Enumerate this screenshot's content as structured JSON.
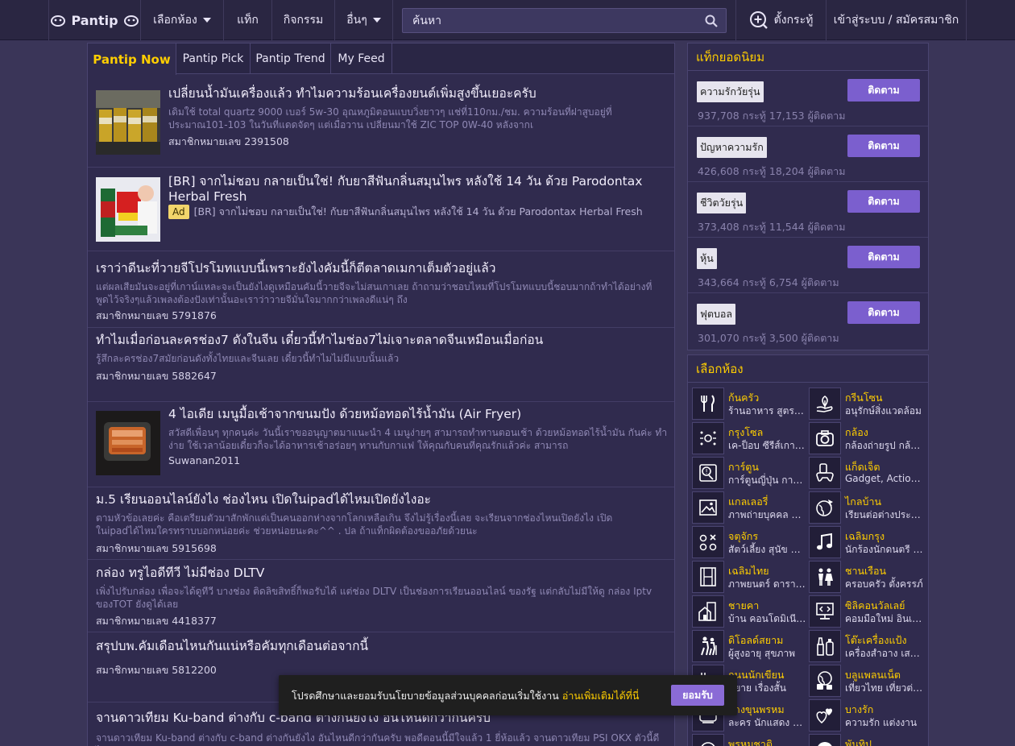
{
  "header": {
    "logo": "Pantip",
    "nav": [
      {
        "label": "เลือกห้อง",
        "dropdown": true
      },
      {
        "label": "แท็ก",
        "dropdown": false
      },
      {
        "label": "กิจกรรม",
        "dropdown": false
      },
      {
        "label": "อื่นๆ",
        "dropdown": true
      }
    ],
    "search_placeholder": "ค้นหา",
    "post_label": "ตั้งกระทู้",
    "login_label": "เข้าสู่ระบบ / สมัครสมาชิก"
  },
  "feed": {
    "tabs": [
      "Pantip Now",
      "Pantip Pick",
      "Pantip Trend",
      "My Feed"
    ],
    "active_tab": "Pantip Now",
    "items": [
      {
        "title": "เปลี่ยนน้ำมันเครื่องแล้ว ทำไมความร้อนเครื่องยนต์เพิ่มสูงขึ้นเยอะครับ",
        "excerpt": "เดิมใช้ total quartz 9000 เบอร์ 5w-30 อุณหภูมิตอนแบบวิ่งยาวๆ แช่ที่110กม./ชม. ความร้อนที่ฝาสูบอยู่ที่ประมาณ101-103 ในวันที่แดดจัดๆ แต่เมื่อวาน เปลี่ยนมาใช้ ZIC TOP 0W-40 หลังจากเ",
        "author": "สมาชิกหมายเลข 2391508",
        "thumb": "oil"
      },
      {
        "title": "[BR] จากไม่ชอบ กลายเป็นใช่! กับยาสีฟันกลิ่นสมุนไพร หลังใช้ 14 วัน ด้วย Parodontax Herbal Fresh",
        "ad_label": "Ad",
        "excerpt": "[BR] จากไม่ชอบ กลายเป็นใช่! กับยาสีฟันกลิ่นสมุนไพร หลังใช้ 14 วัน ด้วย Parodontax Herbal Fresh",
        "thumb": "ad"
      },
      {
        "title": "เราว่าดีนะที่วายจีโปรโมทแบบนี้เพราะยังไงคัมนี้ก็ตีตลาดเมกาเต็มตัวอยู่แล้ว",
        "excerpt": "แต่ผลเสียมันจะอยู่ที่เกาน์แหละจะเป็นยังไงดูเหมือนคัมนี้วายจีจะไม่สนเกาเลย ถ้าถามว่าชอบไหมที่โปรโมทแบบนี้ชอบมากถ้าทำได้อย่างที่พูดไว้จริงๆแล้วเพลงต้องปังเท่านั้นอะเราว่าวายจีมั่นใจมากกว่าเพลงดีแน่ๆ ถึง",
        "author": "สมาชิกหมายเลข 5791876"
      },
      {
        "title": "ทำไมเมื่อก่อนละครช่อง7 ดังในจีน เดี๋ยวนี้ทำไมช่อง7ไม่เจาะตลาดจีนเหมือนเมื่อก่อน",
        "excerpt": "รู้สึกละครช่อง7สมัยก่อนดังทั้งไทยและจีนเลย เดี๋ยวนี้ทำไมไม่มีแบบนั้นแล้ว",
        "author": "สมาชิกหมายเลข 5882647"
      },
      {
        "title": "4 ไอเดีย เมนูมื้อเช้าจากขนมปัง ด้วยหม้อทอดไร้น้ำมัน (Air Fryer)",
        "excerpt": "สวัสดีเพื่อนๆ ทุกคนค่ะ วันนี้เราขออนุญาตมาแนะนำ 4 เมนูง่ายๆ สามารถทำทานตอนเช้า ด้วยหม้อทอดไร้น้ำมัน กันค่ะ ทำง่าย ใช้เวลาน้อยเดี๋ยวก็จะได้อาหารเช้าอร่อยๆ ทานกับกาแฟ ให้คุณกับคนที่คุณรักแล้วค่ะ สามารถ",
        "author": "Suwanan2011",
        "thumb": "bread"
      },
      {
        "title": "ม.5 เรียนออนไลน์ยังไง ช่องไหน เปิดในipadได้ไหมเปิดยังไงอะ",
        "excerpt": "ตามหัวข้อเลยค่ะ คือเตรียมตัวมาสักพักแต่เป็นคนออกห่างจากโลกเหลือเกิน จึงไม่รู้เรื่องนี้เลย จะเรียนจากช่องไหนเปิดยังไง เปิดในipadได้ไหมใครทราบบอกหน่อยค่ะ ช่วยหน่อยนะคะ^^ . ปล ถ้าแท็กผิดต้องขออภัยด้วยนะ",
        "author": "สมาชิกหมายเลข 5915698"
      },
      {
        "title": "กล่อง ทรูไอดีทีวี ไม่มีช่อง DLTV",
        "excerpt": "เพิ่งไปรับกล่อง เพื่อจะได้ดูทีวี บางช่อง ติดลิขสิทธิ์ก็พอรับได้ แต่ช่อง DLTV เป็นช่องการเรียนออนไลน์ ของรัฐ แต่กลับไม่มีให้ดู กล่อง Iptv ของTOT ยังดูได้เลย",
        "author": "สมาชิกหมายเลข 4418377"
      },
      {
        "title": "สรุปบพ.คัมเดือนไหนกันแน่หรือคัมทุกเดือนต่อจากนี้",
        "excerpt": "",
        "author": "สมาชิกหมายเลข 5812200"
      },
      {
        "title": "จานดาวเทียม Ku-band ต่างกับ c-band ต่างกันยังไง อันไหนดีกว่ากันครับ",
        "excerpt": "จานดาวเทียม Ku-band ต่างกับ c-band ต่างกันยังไง อันไหนดีกว่ากันครับ พอดีตอนนี้มีใจแล้ว 1 ยี่ห้อแล้ว จานดาวเทียม PSI OKX ตัวนี้ดีไหม"
      }
    ]
  },
  "tags_panel": {
    "title": "แท็กยอดนิยม",
    "follow_label": "ติดตาม",
    "tags": [
      {
        "name": "ความรักวัยรุ่น",
        "stats": "937,708 กระทู้  17,153 ผู้ติดตาม"
      },
      {
        "name": "ปัญหาความรัก",
        "stats": "426,608 กระทู้  18,204 ผู้ติดตาม"
      },
      {
        "name": "ชีวิตวัยรุ่น",
        "stats": "373,408 กระทู้  11,544 ผู้ติดตาม"
      },
      {
        "name": "หุ้น",
        "stats": "343,664 กระทู้  6,754 ผู้ติดตาม"
      },
      {
        "name": "ฟุตบอล",
        "stats": "301,070 กระทู้  3,500 ผู้ติดตาม"
      }
    ]
  },
  "rooms_panel": {
    "title": "เลือกห้อง",
    "rooms": [
      {
        "name": "ก้นครัว",
        "desc": "ร้านอาหาร สูตรอาหาร",
        "icon": "fork-knife-icon"
      },
      {
        "name": "กรีนโซน",
        "desc": "อนุรักษ์สิ่งแวดล้อม",
        "icon": "leaf-hand-icon"
      },
      {
        "name": "กรุงโซล",
        "desc": "เค-ป็อบ ซีรีส์เกาหลี",
        "icon": "stars-icon"
      },
      {
        "name": "กล้อง",
        "desc": "กล้องถ่ายรูป กล้องวิดีโอ",
        "icon": "camera-icon"
      },
      {
        "name": "การ์ตูน",
        "desc": "การ์ตูนญี่ปุ่น การ์ตูนไทย",
        "icon": "cartoon-icon"
      },
      {
        "name": "แก็ดเจ็ต",
        "desc": "Gadget, Action Cam",
        "icon": "gadget-icon"
      },
      {
        "name": "แกลเลอรี่",
        "desc": "ภาพถ่ายบุคคล ภาพวิว",
        "icon": "gallery-icon"
      },
      {
        "name": "ไกลบ้าน",
        "desc": "เรียนต่อต่างประเทศ",
        "icon": "globe-plane-icon"
      },
      {
        "name": "จตุจักร",
        "desc": "สัตว์เลี้ยง สุนัข แมว",
        "icon": "pet-icon"
      },
      {
        "name": "เฉลิมกรุง",
        "desc": "นักร้องนักดนตรี เพลง",
        "icon": "music-note-icon"
      },
      {
        "name": "เฉลิมไทย",
        "desc": "ภาพยนตร์ ดาราภาพยนตร์",
        "icon": "film-icon"
      },
      {
        "name": "ชานเรือน",
        "desc": "ครอบครัว ตั้งครรภ์",
        "icon": "family-icon"
      },
      {
        "name": "ชายคา",
        "desc": "บ้าน คอนโดมิเนียม",
        "icon": "house-icon"
      },
      {
        "name": "ซิลิคอนวัลเลย์",
        "desc": "คอมมือใหม่ อินเทอร์เน็ต",
        "icon": "computer-code-icon"
      },
      {
        "name": "ดิโอลด์สยาม",
        "desc": "ผู้สูงอายุ สุขภาพ",
        "icon": "elderly-icon"
      },
      {
        "name": "โต๊ะเครื่องแป้ง",
        "desc": "เครื่องสำอาง เสริมสวย",
        "icon": "cosmetics-icon"
      },
      {
        "name": "ถนนนักเขียน",
        "desc": "นิยาย เรื่องสั้น",
        "icon": "writer-icon"
      },
      {
        "name": "บลูแพลนเน็ต",
        "desc": "เที่ยวไทย เที่ยวต่างประเทศ",
        "icon": "travel-icon"
      },
      {
        "name": "บางขุนพรหม",
        "desc": "ละคร นักแสดง ซีรีส์",
        "icon": "tv-icon"
      },
      {
        "name": "บางรัก",
        "desc": "ความรัก แต่งงาน",
        "icon": "hearts-icon"
      },
      {
        "name": "พรหมชาติ",
        "desc": "",
        "icon": "zodiac-icon"
      },
      {
        "name": "พันทิป",
        "desc": "",
        "icon": "pantip-icon"
      }
    ]
  },
  "cookie_bar": {
    "text": "โปรดศึกษาและยอมรับนโยบายข้อมูลส่วนบุคคลก่อนเริ่มใช้งาน",
    "link": "อ่านเพิ่มเติมได้ที่นี่",
    "button": "ยอมรับ"
  },
  "colors": {
    "accent": "#ffce00",
    "primary": "#7b5fce",
    "background": "#3a3558"
  }
}
